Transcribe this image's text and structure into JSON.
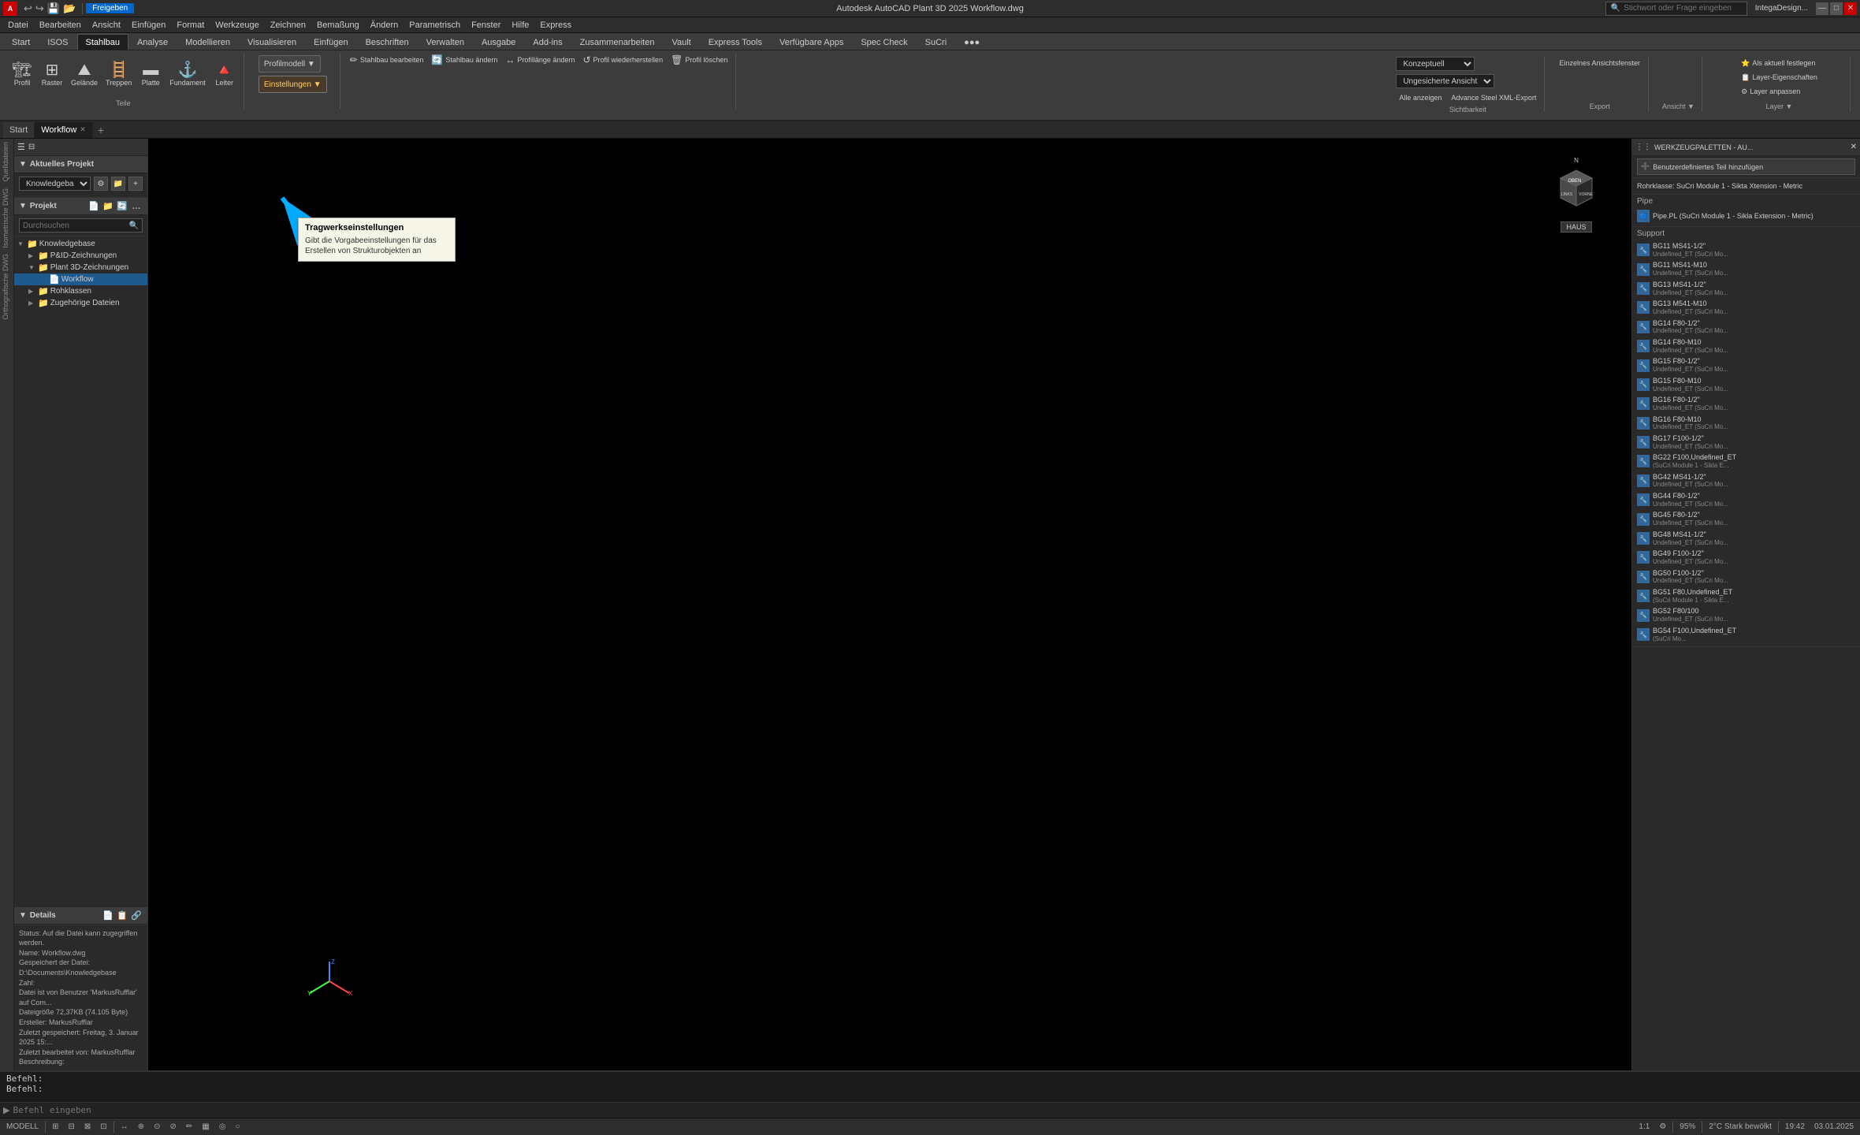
{
  "app": {
    "title": "Autodesk AutoCAD Plant 3D 2025  Workflow.dwg",
    "logo": "A",
    "search_placeholder": "Stichwort oder Frage eingeben"
  },
  "titlebar": {
    "left_items": [
      "A",
      "≡",
      "↩",
      "↪",
      "📌"
    ],
    "freigeben": "Freigeben",
    "search_placeholder": "Stichwort oder Frage eingeben",
    "user": "IntegaDesign...",
    "buttons": [
      "—",
      "□",
      "✕"
    ]
  },
  "menubar": {
    "items": [
      "Datei",
      "Bearbeiten",
      "Ansicht",
      "Einfügen",
      "Format",
      "Werkzeuge",
      "Zeichnen",
      "Bemaßung",
      "Ändern",
      "Parametrisch",
      "Fenster",
      "Hilfe",
      "Express"
    ]
  },
  "ribbon": {
    "tabs": [
      "Start",
      "ISOS",
      "Stahlbau",
      "Analyse",
      "Modellieren",
      "Visualisieren",
      "Einfügen",
      "Beschriften",
      "Verwalten",
      "Ausgabe",
      "Add-ins",
      "Zusammenarbeiten",
      "Vault",
      "Express Tools",
      "Verfügbare Apps",
      "Spec Check",
      "SuCri",
      "●●●"
    ],
    "active_tab": "Stahlbau",
    "groups": [
      {
        "name": "Teile",
        "buttons": [
          "Profil",
          "Raster",
          "Gelände",
          "Treppen",
          "Platte",
          "Fundament",
          "Leiter"
        ]
      },
      {
        "name": "",
        "dropdown": "Profilmodell ▼",
        "sub_buttons": [
          "Einstellungen ▼"
        ]
      },
      {
        "name": "",
        "buttons": [
          "Stahlbau bearbeiten",
          "Stahlbau ändern",
          "Profillänge andern",
          "Profil wiederherstellen",
          "Profil löschen"
        ]
      }
    ],
    "right_section": {
      "dropdown1": "Konzeptuell",
      "dropdown2": "Ungesicherte Ansicht",
      "btn1": "Alle anzeigen",
      "btn2": "Advance Steel XML-Export",
      "btn3": "Einzelnes Ansichtsfenster",
      "layer_section": {
        "btn1": "Als aktuell festlegen",
        "btn2": "Layer-Eigenschaften",
        "btn3": "Layer anpassen"
      }
    }
  },
  "doc_tabs": {
    "tabs": [
      {
        "label": "Start",
        "active": false
      },
      {
        "label": "Workflow",
        "active": true,
        "closeable": true
      }
    ],
    "add_btn": "+"
  },
  "project_panel": {
    "header": "☰",
    "aktuelles_projekt": "Aktuelles Projekt",
    "projekt_name": "Knowledgebase",
    "projekt_section_title": "Projekt",
    "search_placeholder": "Durchsuchen",
    "tree": [
      {
        "level": 0,
        "expanded": true,
        "icon": "📁",
        "label": "Knowledgebase"
      },
      {
        "level": 1,
        "expanded": true,
        "icon": "📁",
        "label": "P&ID-Zeichnungen"
      },
      {
        "level": 1,
        "expanded": true,
        "icon": "📁",
        "label": "Plant 3D-Zeichnungen"
      },
      {
        "level": 2,
        "expanded": false,
        "icon": "📄",
        "label": "Workflow",
        "selected": true
      },
      {
        "level": 1,
        "expanded": false,
        "icon": "📁",
        "label": "Rohklassen"
      },
      {
        "level": 1,
        "expanded": false,
        "icon": "📁",
        "label": "Zugehörige Dateien"
      }
    ]
  },
  "details": {
    "title": "Details",
    "items": [
      "Status: Auf die Datei kann zugegriffen werden.",
      "Name: Workflow.dwg",
      "Gespeichert der Datei: D:\\Documents\\Knowledgebase",
      "Zahl:",
      "Datei ist von Benutzer 'MarkusRufflar' auf Computer",
      "Dateigröße 72,37KB (74.105 Byte)",
      "Ersteller: MarkusRufflar",
      "Zuletzt gespeichert: Freitag, 3. Januar 2025 15:...",
      "Zuletzt bearbeitet von: MarkusRufflar",
      "Beschreibung:"
    ]
  },
  "tooltip": {
    "title": "Tragwerkseinstellungen",
    "body": "Gibt die Vorgabeeinstellungen für das Erstellen von Strukturobjekten an"
  },
  "canvas": {
    "background": "#000000"
  },
  "right_panel": {
    "header": "WERKZEUGPALETTEN - AU...",
    "btn_add": "Benutzerdefiniertes Teil hinzufügen",
    "class_label": "Rohrklasse: SuCri Module 1 - Sikta Xtension - Metric",
    "section_pipe": "Pipe",
    "pipe_item": "Pipe.PL (SuCri Module 1 - Sikla Extension - Metric)",
    "section_support": "Support",
    "support_items": [
      {
        "id": "BG11",
        "label": "BG11 MS41-1/2\"",
        "sub": "Undefined_ET (SuCri Mo..."
      },
      {
        "id": "BG11b",
        "label": "BG11 MS41-M10",
        "sub": "Undefined_ET (SuCri Mo..."
      },
      {
        "id": "BG13",
        "label": "BG13 MS41-1/2\"",
        "sub": "Undefined_ET (SuCri Mo..."
      },
      {
        "id": "BG13b",
        "label": "BG13 M541-M10",
        "sub": "Undefined_ET (SuCri Mo..."
      },
      {
        "id": "BG14",
        "label": "BG14 F80-1/2\"",
        "sub": "Undefined_ET (SuCri Mo..."
      },
      {
        "id": "BG14b",
        "label": "BG14 F80-M10",
        "sub": "Undefined_ET (SuCri Mo..."
      },
      {
        "id": "BG15",
        "label": "BG15 F80-1/2\"",
        "sub": "Undefined_ET (SuCri Mo..."
      },
      {
        "id": "BG15b",
        "label": "BG15 F80-M10",
        "sub": "Undefined_ET (SuCri Mo..."
      },
      {
        "id": "BG16",
        "label": "BG16 F80-1/2\"",
        "sub": "Undefined_ET (SuCri Mo..."
      },
      {
        "id": "BG16b",
        "label": "BG16 F80-M10",
        "sub": "Undefined_ET (SuCri Mo..."
      },
      {
        "id": "BG17",
        "label": "BG17 F100-1/2\"",
        "sub": "Undefined_ET (SuCri Mo..."
      },
      {
        "id": "BG22",
        "label": "BG22 F100,Undefined_ET",
        "sub": "(SuCri Module 1 - Sikla E..."
      },
      {
        "id": "BG42",
        "label": "BG42 MS41-1/2\"",
        "sub": "Undefined_ET (SuCri Mo..."
      },
      {
        "id": "BG44",
        "label": "BG44 F80-1/2\"",
        "sub": "Undefined_ET (SuCri Mo..."
      },
      {
        "id": "BG45",
        "label": "BG45 F80-1/2\"",
        "sub": "Undefined_ET (SuCri Mo..."
      },
      {
        "id": "BG48",
        "label": "BG48 MS41-1/2\"",
        "sub": "Undefined_ET (SuCri Mo..."
      },
      {
        "id": "BG49",
        "label": "BG49 F100-1/2\"",
        "sub": "Undefined_ET (SuCri Mo..."
      },
      {
        "id": "BG50",
        "label": "BG50 F100-1/2\"",
        "sub": "Undefined_ET (SuCri Mo..."
      },
      {
        "id": "BG51",
        "label": "BG51 F80,Undefined_ET",
        "sub": "(SuCri Module 1 - Sikla E..."
      },
      {
        "id": "BG52",
        "label": "BG52 F80/100",
        "sub": "Undefined_ET (SuCri Mo..."
      },
      {
        "id": "BG54",
        "label": "BG54 F100,Undefined_ET",
        "sub": "(SuCri Mo..."
      }
    ]
  },
  "cmdline": {
    "lines": [
      "Befehl:",
      "Befehl:"
    ],
    "prompt": "▶",
    "input_placeholder": "Befehl eingeben"
  },
  "statusbar": {
    "left_items": [
      "MODELL",
      "⊞",
      "⊟",
      "⊠",
      "⊡"
    ],
    "items": [
      "↔",
      "⊕",
      "⊙",
      "⊘",
      "✏",
      "▦",
      "◎",
      "○",
      "⌨",
      "A",
      "1:1",
      "⚙"
    ],
    "zoom": "95%",
    "weather": "2°C Stark bewölkt",
    "time": "19:42",
    "date": "03.01.2025"
  },
  "left_sidebar_tabs": [
    {
      "label": "Quelldateien"
    },
    {
      "label": "Isometrische DWG"
    },
    {
      "label": "Orthografische DWG"
    }
  ]
}
